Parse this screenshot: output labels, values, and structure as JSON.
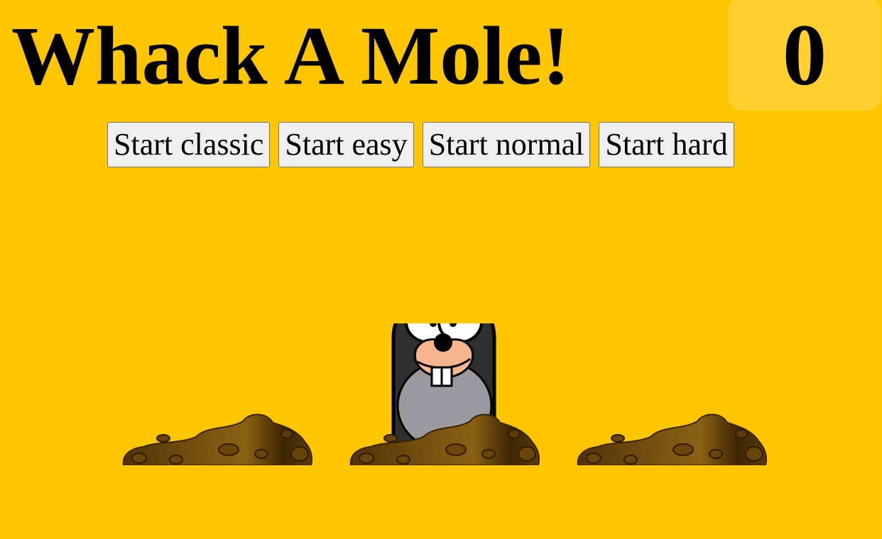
{
  "game": {
    "title": "Whack A Mole!",
    "score": "0"
  },
  "controls": {
    "buttons": [
      {
        "label": "Start classic"
      },
      {
        "label": "Start easy"
      },
      {
        "label": "Start normal"
      },
      {
        "label": "Start hard"
      }
    ]
  },
  "board": {
    "holes": [
      {
        "mole_visible": false
      },
      {
        "mole_visible": true
      },
      {
        "mole_visible": false
      }
    ]
  },
  "colors": {
    "background": "#ffc600",
    "score_box": "#ffd02e",
    "dirt": "#6b4a10"
  }
}
